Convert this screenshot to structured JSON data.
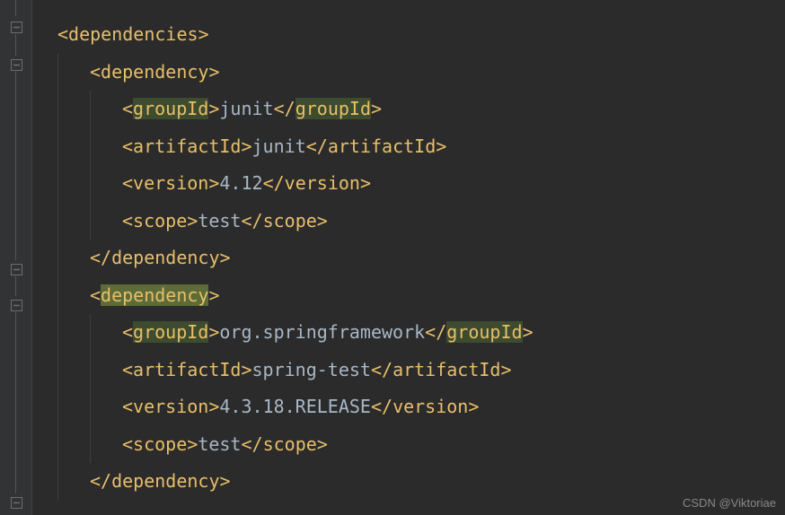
{
  "code": {
    "dependencies_open": "dependencies",
    "dependency_open": "dependency",
    "dependency_close": "dependency",
    "groupId": "groupId",
    "artifactId": "artifactId",
    "version": "version",
    "scope": "scope",
    "dep1": {
      "groupId": "junit",
      "artifactId": "junit",
      "version": "4.12",
      "scope": "test"
    },
    "dep2": {
      "groupId": "org.springframework",
      "artifactId": "spring-test",
      "version": "4.3.18.RELEASE",
      "scope": "test"
    }
  },
  "watermark": "CSDN @Viktoriae"
}
